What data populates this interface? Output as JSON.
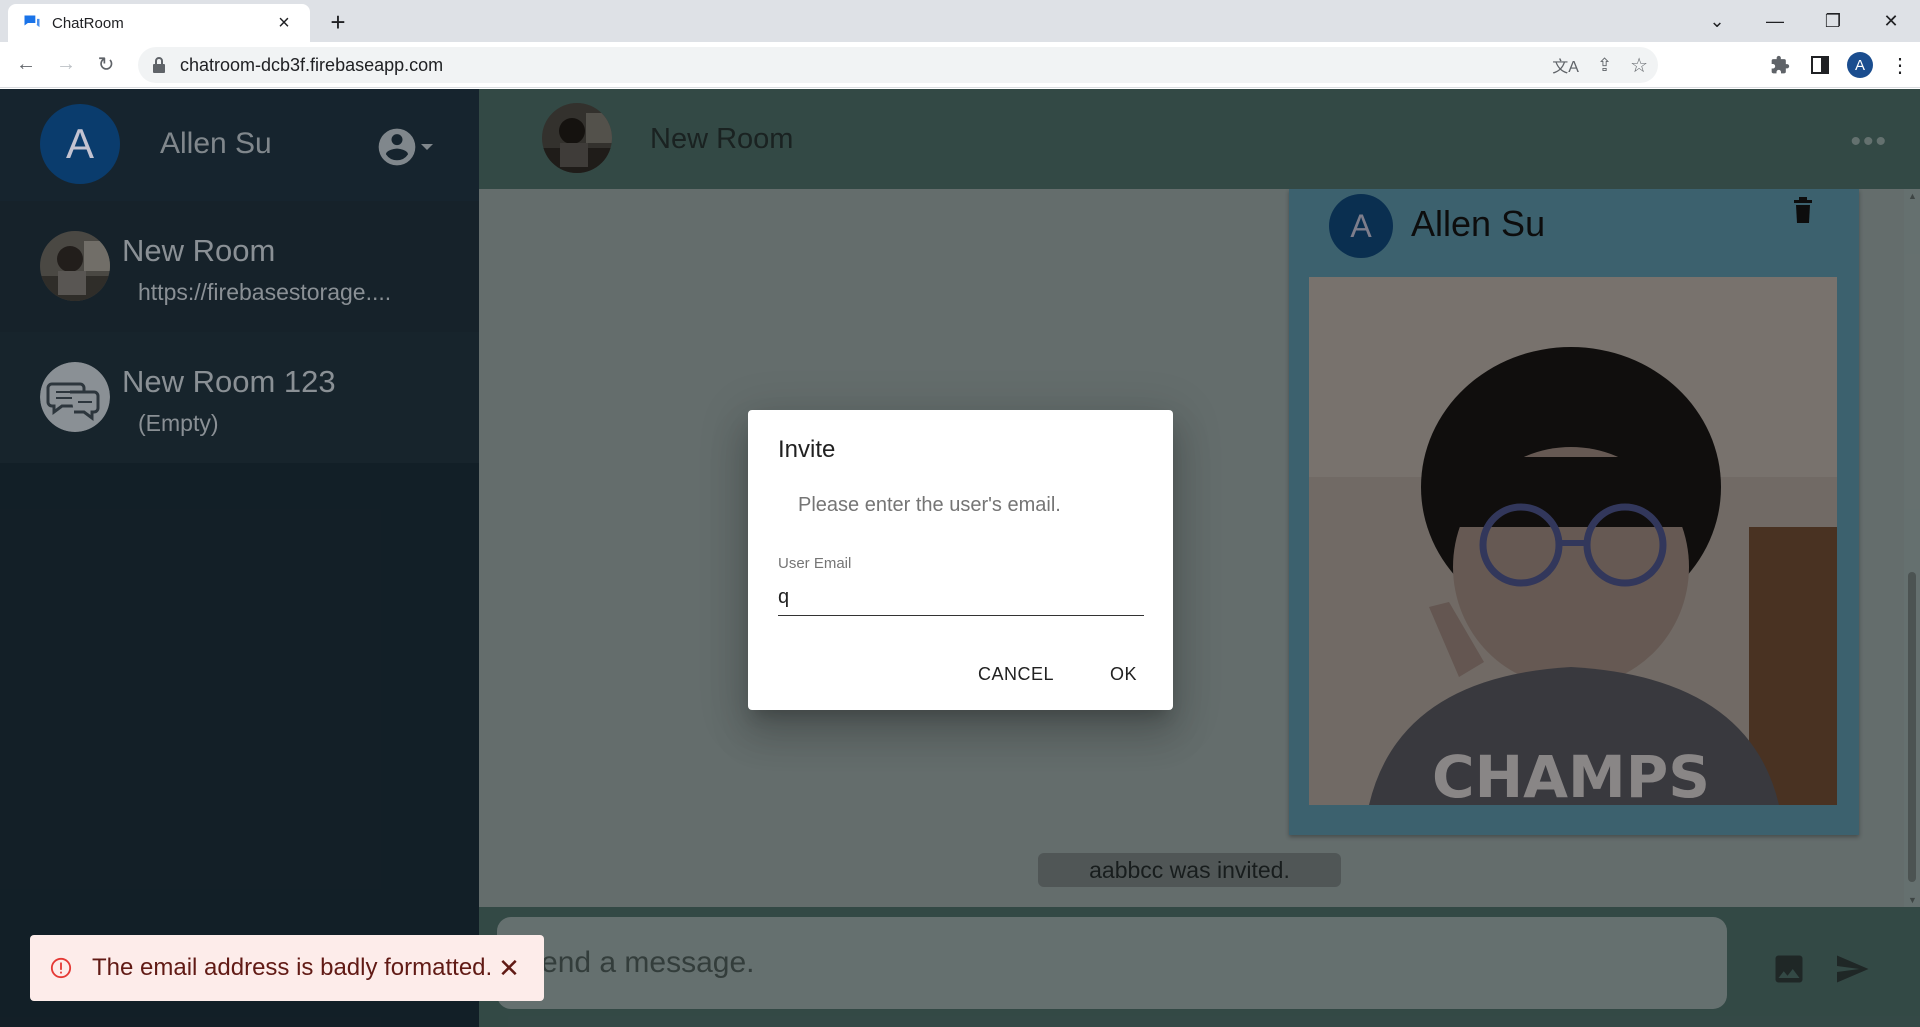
{
  "browser": {
    "tab_title": "ChatRoom",
    "url": "chatroom-dcb3f.firebaseapp.com",
    "profile_initial": "A",
    "colors": {
      "tabbar": "#dee1e6",
      "favicon": "#1a73e8"
    }
  },
  "sidebar": {
    "user_initial": "A",
    "user_name": "Allen Su",
    "rooms": [
      {
        "name": "New Room",
        "preview": "https://firebasestorage...."
      },
      {
        "name": "New Room 123",
        "preview": "(Empty)"
      }
    ]
  },
  "chat": {
    "room_title": "New Room",
    "more_label": "•••",
    "message": {
      "author_initial": "A",
      "author": "Allen Su",
      "image_alt": "CHAMPS"
    },
    "system_message": "aabbcc was invited.",
    "composer_placeholder": "Send a message."
  },
  "dialog": {
    "title": "Invite",
    "text": "Please enter the user's email.",
    "field_label": "User Email",
    "field_value": "q",
    "cancel_label": "CANCEL",
    "ok_label": "OK"
  },
  "snackbar": {
    "message": "The email address is badly formatted.",
    "close_label": "✕"
  },
  "colors": {
    "sidebar_bg": "#172630",
    "chat_header_bg": "#3f5a55",
    "avatar_blue": "#0d4a86",
    "error_bg": "#fdecea",
    "error_red": "#e53935"
  }
}
